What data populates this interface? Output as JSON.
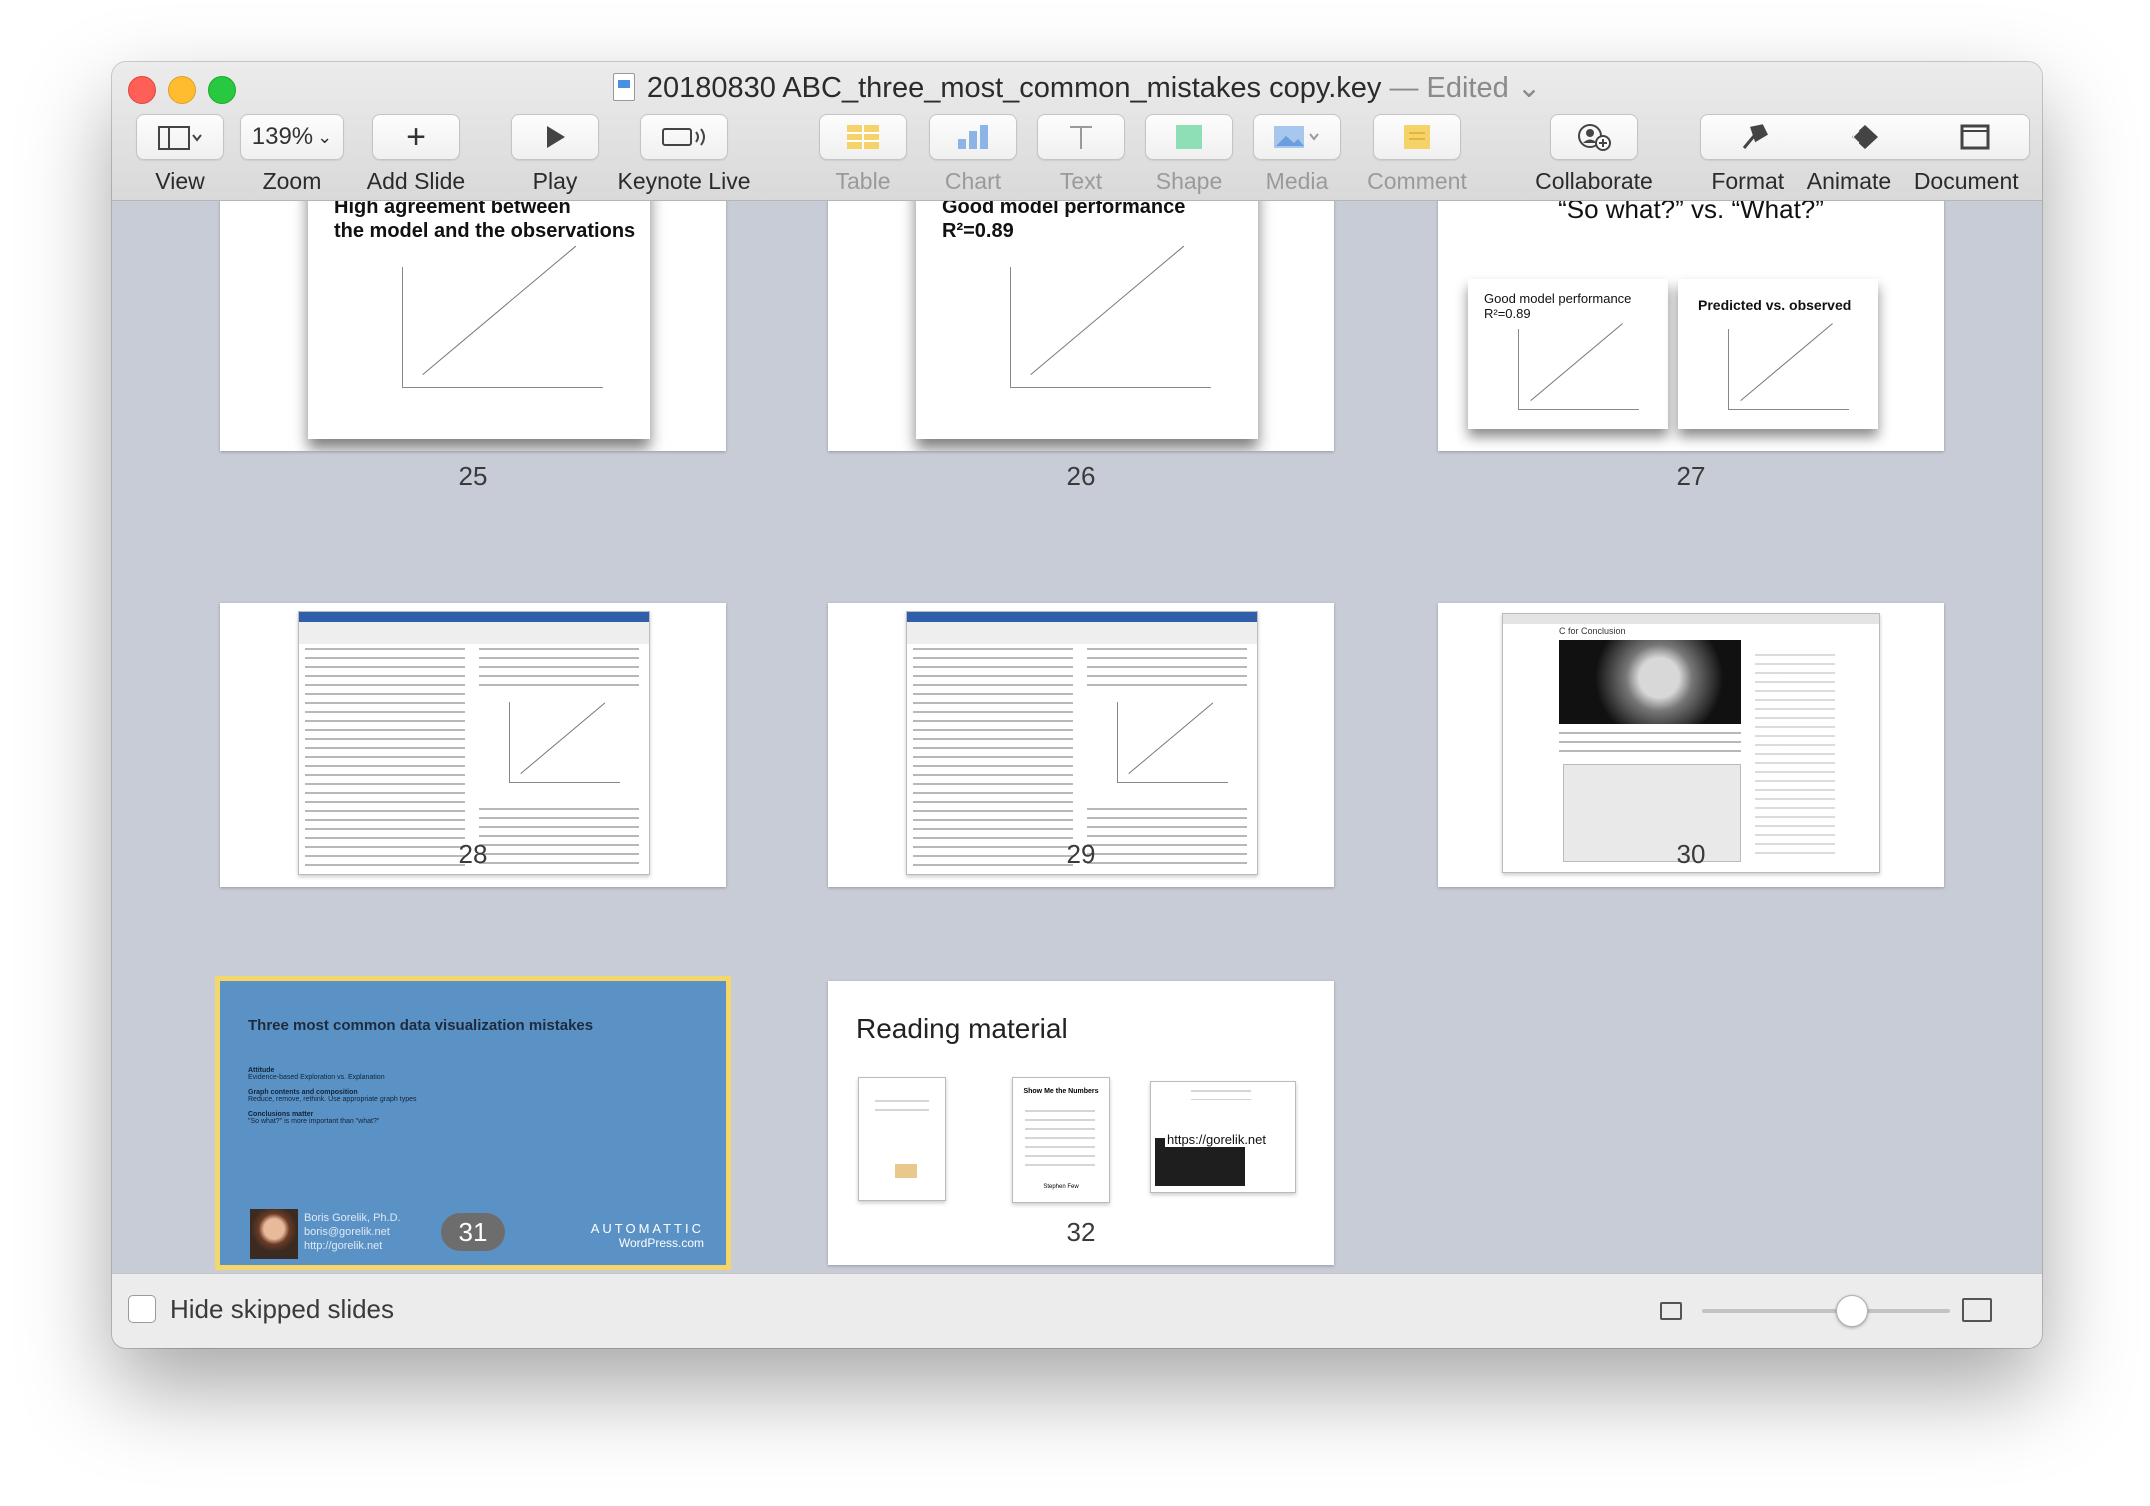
{
  "window": {
    "title": "20180830 ABC_three_most_common_mistakes copy.key",
    "status": "— Edited",
    "status_chevron": "⌄"
  },
  "toolbar": {
    "view": "View",
    "zoom_value": "139%",
    "zoom": "Zoom",
    "add_slide": "Add Slide",
    "play": "Play",
    "keynote_live": "Keynote Live",
    "table": "Table",
    "chart": "Chart",
    "text": "Text",
    "shape": "Shape",
    "media": "Media",
    "comment": "Comment",
    "collaborate": "Collaborate",
    "format": "Format",
    "animate": "Animate",
    "document": "Document"
  },
  "slides": [
    {
      "number": "25",
      "title": "High agreement between\nthe model and the observations"
    },
    {
      "number": "26",
      "title": "Good model performance\nR²=0.89"
    },
    {
      "number": "27",
      "title": "“So what?” vs. “What?”",
      "left_card": "Good model performance\nR²=0.89",
      "right_card": "Predicted vs. observed"
    },
    {
      "number": "28"
    },
    {
      "number": "29"
    },
    {
      "number": "30",
      "title": "C for Conclusion"
    },
    {
      "number": "31",
      "title": "Three most common data visualization mistakes",
      "items": [
        {
          "heading": "Attitude",
          "sub": "Evidence-based Exploration vs. Explanation"
        },
        {
          "heading": "Graph contents and composition",
          "sub": "Reduce, remove, rethink. Use appropriate graph types"
        },
        {
          "heading": "Conclusions matter",
          "sub": "\"So what?\" is more important than \"what?\""
        }
      ],
      "author": "Boris Gorelik, Ph.D.",
      "email": "boris@gorelik.net",
      "url": "http://gorelik.net",
      "brand": "AUTOMATTIC",
      "brand_sub": "WordPress.com"
    },
    {
      "number": "32",
      "title": "Reading material",
      "book2": "Show Me the Numbers",
      "book2_author": "Stephen Few",
      "link": "https://gorelik.net"
    }
  ],
  "footer": {
    "hide_skipped": "Hide skipped slides",
    "zoom_slider_value": 0.6
  }
}
